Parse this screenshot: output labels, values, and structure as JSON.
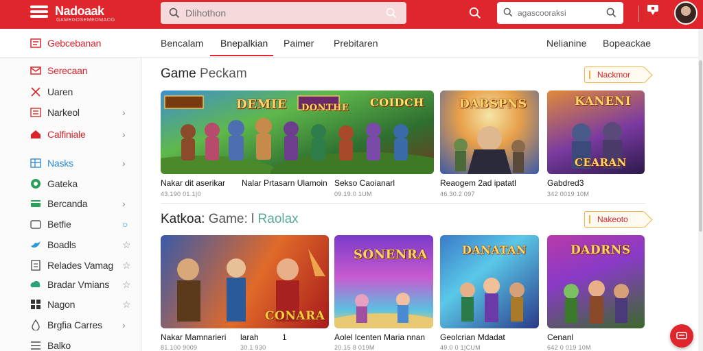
{
  "app": {
    "logo_text": "Nadoaak",
    "logo_sub": "GAMEGOSEMEOMAOG",
    "search_placeholder": "Dlihothon",
    "search2_placeholder": "agascooraksi",
    "brand_color": "#e0262d"
  },
  "sidebar": {
    "top_item": {
      "label": "Gebcebanan",
      "icon": "grid-icon"
    },
    "items": [
      {
        "label": "Serecaan",
        "icon": "mail-icon",
        "style": "red",
        "trail": ""
      },
      {
        "label": "Uaren",
        "icon": "swords-icon",
        "style": "",
        "trail": ""
      },
      {
        "label": "Narkeol",
        "icon": "list-icon",
        "style": "",
        "trail": "›"
      },
      {
        "label": "Calfiniale",
        "icon": "home-icon",
        "style": "red",
        "trail": "›"
      },
      {
        "label": "Nasks",
        "icon": "board-icon",
        "style": "blue",
        "trail": "›"
      },
      {
        "label": "Gateka",
        "icon": "circle-g-icon",
        "style": "",
        "trail": ""
      },
      {
        "label": "Bercanda",
        "icon": "card-icon",
        "style": "",
        "trail": "›"
      },
      {
        "label": "Betfie",
        "icon": "folder-icon",
        "style": "",
        "trail": "○"
      },
      {
        "label": "Boadls",
        "icon": "bird-icon",
        "style": "",
        "trail": "☆"
      },
      {
        "label": "Relades Vamag",
        "icon": "doc-icon",
        "style": "",
        "trail": "☆"
      },
      {
        "label": "Bradar Vmians",
        "icon": "cloud-icon",
        "style": "",
        "trail": "☆"
      },
      {
        "label": "Nagon",
        "icon": "grid4-icon",
        "style": "",
        "trail": "☆"
      },
      {
        "label": "Brgfia Carres",
        "icon": "drop-icon",
        "style": "",
        "trail": "›"
      },
      {
        "label": "Balko",
        "icon": "menu-icon",
        "style": "",
        "trail": ""
      }
    ]
  },
  "tabs": {
    "left": [
      "Bencalam",
      "Bnepalkian",
      "Paimer",
      "Prebitaren"
    ],
    "active_index": 1,
    "right": [
      "Nelianine",
      "Bopeackae"
    ]
  },
  "section1": {
    "title_bold": "Game",
    "title_light": "Peckam",
    "button": "Nackmor",
    "cards": [
      {
        "title": "Nakar dit aserikar",
        "meta": "43.190 01.1|0",
        "art": [
          "DEMIE",
          "DONTHE",
          "COIDCH"
        ]
      },
      {
        "title": "Nalar Prtasarn Ulamoin",
        "meta": "",
        "art": []
      },
      {
        "title": "Sekso Caoianarl",
        "meta": "09.19.0 1UM",
        "art": []
      },
      {
        "title": "Reaogem 2ad ipatatl",
        "meta": "46.30.2 097",
        "art": [
          "DABSPNS"
        ]
      },
      {
        "title": "Gabdred3",
        "meta": "342 0019 10M",
        "art": [
          "KANENI",
          "CEARAN"
        ]
      }
    ]
  },
  "section2": {
    "title_bold": "Katkoa:",
    "title_light": "Game: l",
    "title_teal": "Raolax",
    "button": "Nakeoto",
    "cards": [
      {
        "title": "Nakar Mamnarieri",
        "meta": "81.100 9009",
        "art": [
          "CONARA"
        ]
      },
      {
        "title": "larah",
        "meta": "30.1 930",
        "art": []
      },
      {
        "title": "1",
        "meta": "",
        "art": []
      },
      {
        "title": "Aolel lcenten Maria nnan",
        "meta": "20.15 8 019M",
        "art": [
          "SONENRA"
        ]
      },
      {
        "title": "Geolcrian Mdadat",
        "meta": "49.0 0 1|CUM",
        "art": [
          "DANATAN"
        ]
      },
      {
        "title": "Cenanl",
        "meta": "642 0 019 10M",
        "art": [
          "DADRNS"
        ]
      }
    ]
  }
}
